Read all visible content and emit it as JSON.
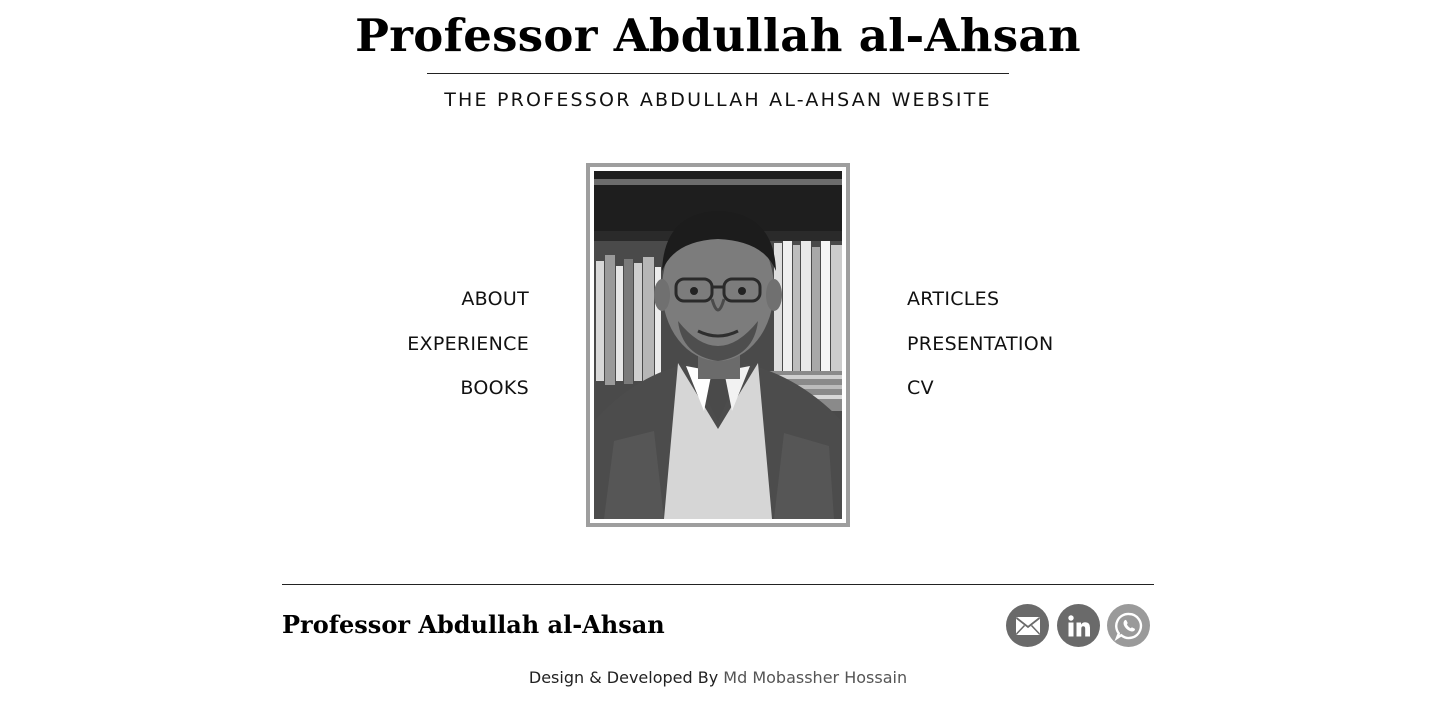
{
  "header": {
    "title": "Professor Abdullah al-Ahsan",
    "tagline": "THE PROFESSOR ABDULLAH AL-AHSAN WEBSITE"
  },
  "nav": {
    "left": [
      {
        "label": "ABOUT"
      },
      {
        "label": "EXPERIENCE"
      },
      {
        "label": "BOOKS"
      }
    ],
    "right": [
      {
        "label": "ARTICLES"
      },
      {
        "label": "PRESENTATION"
      },
      {
        "label": "CV"
      }
    ]
  },
  "portrait": {
    "alt": "portrait-photo"
  },
  "footer": {
    "name": "Professor Abdullah al-Ahsan",
    "social": [
      {
        "icon": "mail-icon"
      },
      {
        "icon": "linkedin-icon"
      },
      {
        "icon": "whatsapp-icon"
      }
    ],
    "credits_prefix": "Design & Developed By",
    "credits_author": "Md Mobassher Hossain"
  },
  "colors": {
    "text": "#111111",
    "frame": "#9e9e9e",
    "social_dark": "#6a6a6a",
    "social_light": "#9a9a9a",
    "credit_link": "#555555"
  }
}
